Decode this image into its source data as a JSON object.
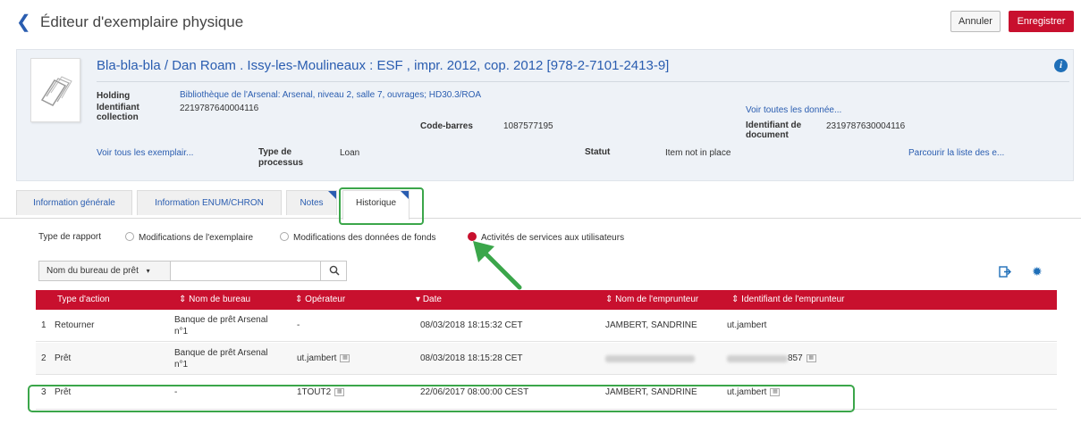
{
  "header": {
    "title": "Éditeur d'exemplaire physique",
    "cancel_label": "Annuler",
    "save_label": "Enregistrer"
  },
  "record": {
    "title": "Bla-bla-bla / Dan Roam . Issy-les-Moulineaux : ESF , impr. 2012, cop. 2012 [978-2-7101-2413-9]",
    "holding_label": "Holding",
    "holding_value": "Bibliothèque de l'Arsenal: Arsenal, niveau 2, salle 7, ouvrages; HD30.3/ROA",
    "collection_id_label_1": "Identifiant",
    "collection_id_label_2": "collection",
    "collection_id_value": "2219787640004116",
    "barcode_label": "Code-barres",
    "barcode_value": "1087577195",
    "view_all_data_link": "Voir toutes les donnée...",
    "document_id_label_1": "Identifiant de",
    "document_id_label_2": "document",
    "document_id_value": "2319787630004116",
    "view_all_items_link": "Voir tous les exemplair...",
    "process_type_label_1": "Type de",
    "process_type_label_2": "processus",
    "process_type_value": "Loan",
    "status_label": "Statut",
    "status_value": "Item not in place",
    "browse_list_link": "Parcourir la liste des e..."
  },
  "tabs": [
    {
      "label": "Information générale"
    },
    {
      "label": "Information ENUM/CHRON"
    },
    {
      "label": "Notes"
    },
    {
      "label": "Historique"
    }
  ],
  "report": {
    "label": "Type de rapport",
    "options": [
      {
        "label": "Modifications de l'exemplaire",
        "selected": false
      },
      {
        "label": "Modifications des données de fonds",
        "selected": false
      },
      {
        "label": "Activités de services aux utilisateurs",
        "selected": true
      }
    ]
  },
  "filter": {
    "field_label": "Nom du bureau de prêt",
    "search_value": ""
  },
  "table": {
    "headers": [
      "Type d'action",
      "Nom de bureau",
      "Opérateur",
      "Date",
      "Nom de l'emprunteur",
      "Identifiant de l'emprunteur"
    ],
    "rows": [
      {
        "num": "1",
        "action": "Retourner",
        "desk_1": "Banque de prêt Arsenal",
        "desk_2": "n°1",
        "operator": "-",
        "date": "08/03/2018 18:15:32 CET",
        "borrower": "JAMBERT, SANDRINE",
        "borrower_id": "ut.jambert"
      },
      {
        "num": "2",
        "action": "Prêt",
        "desk_1": "Banque de prêt Arsenal",
        "desk_2": "n°1",
        "operator": "ut.jambert",
        "date": "08/03/2018 18:15:28 CET",
        "borrower": "",
        "borrower_id": "857"
      },
      {
        "num": "3",
        "action": "Prêt",
        "desk_1": "-",
        "desk_2": "",
        "operator": "1TOUT2",
        "date": "22/06/2017 08:00:00 CEST",
        "borrower": "JAMBERT, SANDRINE",
        "borrower_id": "ut.jambert"
      }
    ]
  },
  "colors": {
    "accent_red": "#c8102e",
    "link_blue": "#2a5db0",
    "highlight_green": "#3ba64a"
  }
}
